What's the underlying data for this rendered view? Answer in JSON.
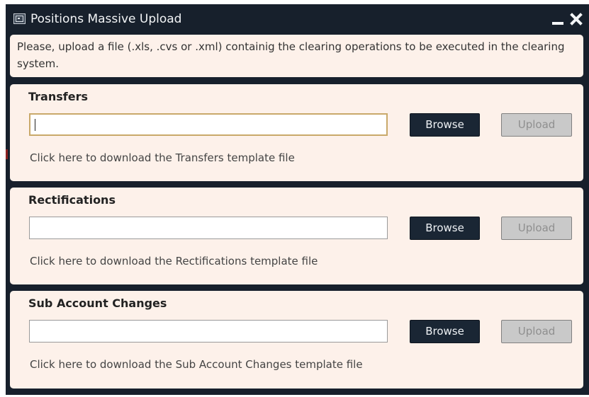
{
  "window": {
    "title": "Positions Massive Upload",
    "icon": "app-window-icon",
    "controls": {
      "minimize_icon": "minimize-icon",
      "close_icon": "close-icon"
    }
  },
  "intro": {
    "text": "Please, upload a file (.xls, .cvs or .xml) containig the clearing operations to be executed in the clearing system."
  },
  "sections": [
    {
      "title": "Transfers",
      "file_value": "",
      "browse_label": "Browse",
      "upload_label": "Upload",
      "upload_enabled": false,
      "link_text": "Click here to download the Transfers template file"
    },
    {
      "title": "Rectifications",
      "file_value": "",
      "browse_label": "Browse",
      "upload_label": "Upload",
      "upload_enabled": false,
      "link_text": "Click here to download the Rectifications template file"
    },
    {
      "title": "Sub Account Changes",
      "file_value": "",
      "browse_label": "Browse",
      "upload_label": "Upload",
      "upload_enabled": false,
      "link_text": "Click here to download the Sub Account Changes template file"
    }
  ],
  "colors": {
    "titlebar": "#17202c",
    "panel": "#fdf1ea",
    "browse_button": "#1a2634",
    "upload_disabled": "#c9c9c9",
    "focus_border": "#c9a96a"
  }
}
